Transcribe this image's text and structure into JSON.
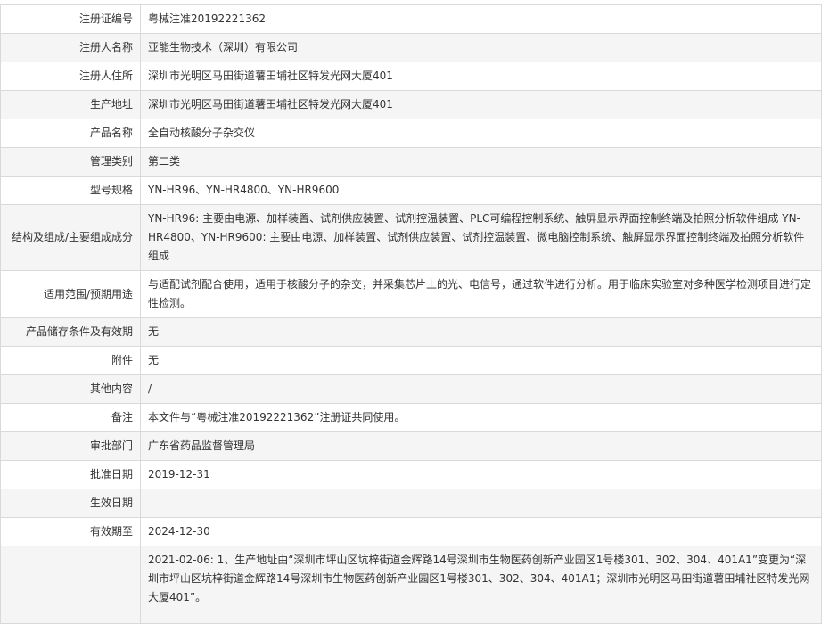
{
  "rows": [
    {
      "label": "注册证编号",
      "value": "粤械注准20192221362"
    },
    {
      "label": "注册人名称",
      "value": "亚能生物技术（深圳）有限公司"
    },
    {
      "label": "注册人住所",
      "value": "深圳市光明区马田街道薯田埔社区特发光网大厦401"
    },
    {
      "label": "生产地址",
      "value": "深圳市光明区马田街道薯田埔社区特发光网大厦401"
    },
    {
      "label": "产品名称",
      "value": "全自动核酸分子杂交仪"
    },
    {
      "label": "管理类别",
      "value": "第二类"
    },
    {
      "label": "型号规格",
      "value": "YN-HR96、YN-HR4800、YN-HR9600"
    },
    {
      "label": "结构及组成/主要组成成分",
      "value": "YN-HR96: 主要由电源、加样装置、试剂供应装置、试剂控温装置、PLC可编程控制系统、触屏显示界面控制终端及拍照分析软件组成 YN-HR4800、YN-HR9600: 主要由电源、加样装置、试剂供应装置、试剂控温装置、微电脑控制系统、触屏显示界面控制终端及拍照分析软件组成"
    },
    {
      "label": "适用范围/预期用途",
      "value": "与适配试剂配合使用，适用于核酸分子的杂交，并采集芯片上的光、电信号，通过软件进行分析。用于临床实验室对多种医学检测项目进行定性检测。"
    },
    {
      "label": "产品储存条件及有效期",
      "value": "无"
    },
    {
      "label": "附件",
      "value": "无"
    },
    {
      "label": "其他内容",
      "value": "/"
    },
    {
      "label": "备注",
      "value": "本文件与“粤械注准20192221362”注册证共同使用。"
    },
    {
      "label": "审批部门",
      "value": "广东省药品监督管理局"
    },
    {
      "label": "批准日期",
      "value": "2019-12-31"
    },
    {
      "label": "生效日期",
      "value": ""
    },
    {
      "label": "有效期至",
      "value": "2024-12-30"
    },
    {
      "label": "",
      "value": "2021-02-06: 1、生产地址由“深圳市坪山区坑梓街道金辉路14号深圳市生物医药创新产业园区1号楼301、302、304、401A1”变更为“深圳市坪山区坑梓街道金辉路14号深圳市生物医药创新产业园区1号楼301、302、304、401A1；深圳市光明区马田街道薯田埔社区特发光网大厦401”。"
    }
  ]
}
